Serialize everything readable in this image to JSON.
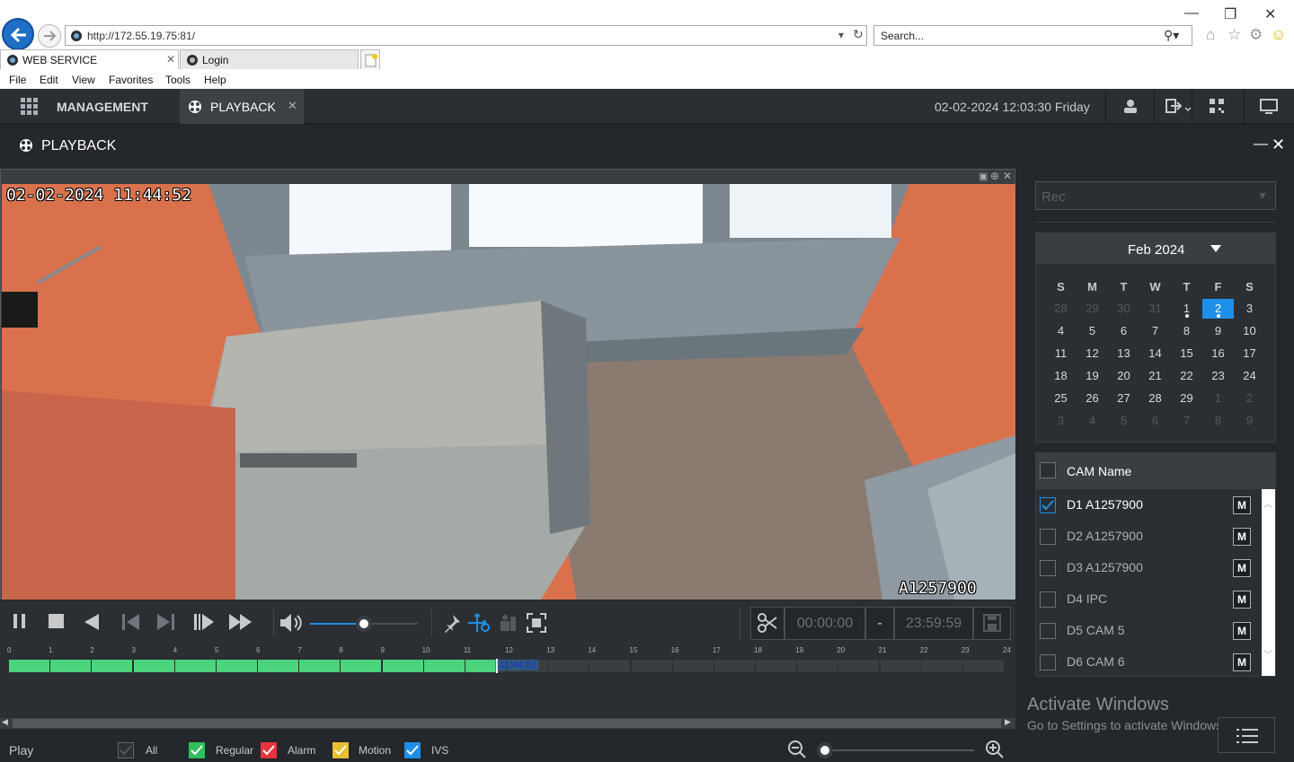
{
  "browser": {
    "url": "http://172.55.19.75:81/",
    "search_placeholder": "Search...",
    "tabs": [
      {
        "label": "WEB SERVICE"
      },
      {
        "label": "Login"
      }
    ],
    "menu": [
      "File",
      "Edit",
      "View",
      "Favorites",
      "Tools",
      "Help"
    ]
  },
  "app": {
    "nav": {
      "management": "MANAGEMENT",
      "playback": "PLAYBACK"
    },
    "datetime": "02-02-2024 12:03:30 Friday",
    "page_title": "PLAYBACK"
  },
  "video": {
    "osd_time": "02-02-2024 11:44:52",
    "osd_name": "A1257900"
  },
  "controls": {
    "start_time": "00:00:00",
    "separator": "-",
    "end_time": "23:59:59",
    "volume": 0.5
  },
  "timeline": {
    "hours": [
      "0",
      "1",
      "2",
      "3",
      "4",
      "5",
      "6",
      "7",
      "8",
      "9",
      "10",
      "11",
      "12",
      "13",
      "14",
      "15",
      "16",
      "17",
      "18",
      "19",
      "20",
      "21",
      "22",
      "23",
      "24"
    ],
    "recorded_until_hour": 11.75,
    "cursor_label": "11:44:52",
    "recorded_color": "#4cd47c"
  },
  "legend": {
    "play_label": "Play",
    "items": [
      {
        "label": "All",
        "color": "#2b2f33"
      },
      {
        "label": "Regular",
        "color": "#2fbf5c"
      },
      {
        "label": "Alarm",
        "color": "#e8343c"
      },
      {
        "label": "Motion",
        "color": "#e8c02c"
      },
      {
        "label": "IVS",
        "color": "#1e8fe8"
      }
    ]
  },
  "panel": {
    "rec_type": "Rec",
    "calendar": {
      "month_label": "Feb 2024",
      "dow": [
        "S",
        "M",
        "T",
        "W",
        "T",
        "F",
        "S"
      ],
      "weeks": [
        [
          "28",
          "29",
          "30",
          "31",
          "1",
          "2",
          "3"
        ],
        [
          "4",
          "5",
          "6",
          "7",
          "8",
          "9",
          "10"
        ],
        [
          "11",
          "12",
          "13",
          "14",
          "15",
          "16",
          "17"
        ],
        [
          "18",
          "19",
          "20",
          "21",
          "22",
          "23",
          "24"
        ],
        [
          "25",
          "26",
          "27",
          "28",
          "29",
          "1",
          "2"
        ],
        [
          "3",
          "4",
          "5",
          "6",
          "7",
          "8",
          "9"
        ]
      ],
      "selected": "2"
    },
    "cam_header": "CAM Name",
    "cameras": [
      {
        "name": "D1 A1257900",
        "checked": true,
        "mode": "M"
      },
      {
        "name": "D2 A1257900",
        "checked": false,
        "mode": "M"
      },
      {
        "name": "D3 A1257900",
        "checked": false,
        "mode": "M"
      },
      {
        "name": "D4 IPC",
        "checked": false,
        "mode": "M"
      },
      {
        "name": "D5 CAM 5",
        "checked": false,
        "mode": "M"
      },
      {
        "name": "D6 CAM 6",
        "checked": false,
        "mode": "M"
      }
    ],
    "activate_title": "Activate Windows",
    "activate_sub": "Go to Settings to activate Windows."
  }
}
